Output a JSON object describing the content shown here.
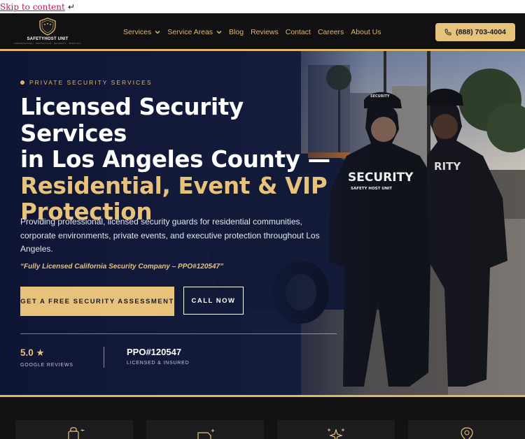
{
  "skip_link": {
    "label": "Skip to content",
    "return_glyph": "↵"
  },
  "brand": {
    "name": "SAFETYHOST UNIT",
    "tagline": "PROFESSIONAL · PROTECTION · SECURITY · SERVICES"
  },
  "nav": {
    "items": [
      {
        "label": "Services",
        "has_dropdown": true
      },
      {
        "label": "Service Areas",
        "has_dropdown": true
      },
      {
        "label": "Blog",
        "has_dropdown": false
      },
      {
        "label": "Reviews",
        "has_dropdown": false
      },
      {
        "label": "Contact",
        "has_dropdown": false
      },
      {
        "label": "Careers",
        "has_dropdown": false
      },
      {
        "label": "About Us",
        "has_dropdown": false
      }
    ],
    "phone": "(888) 703-4004"
  },
  "hero": {
    "eyebrow": "PRIVATE SECURITY SERVICES",
    "headline_white_1": "Licensed Security Services",
    "headline_white_2": "in Los Angeles County —",
    "headline_gold_1": "Residential, Event & VIP",
    "headline_gold_2": "Protection",
    "description": "Providing professional, licensed security guards for residential communities, corporate environments, private events, and executive protection throughout Los Angeles.",
    "license_line": "“Fully Licensed California Security Company – PPO#120547”",
    "cta_primary": "GET A FREE SECURITY ASSESSMENT",
    "cta_secondary": "CALL NOW",
    "stats": [
      {
        "value": "5.0 ★",
        "label": "GOOGLE REVIEWS"
      },
      {
        "value": "PPO#120547",
        "label": "LICENSED & INSURED"
      }
    ],
    "image_text": {
      "vest_1": "SECURITY",
      "vest_1_sub": "SAFETY HOST UNIT",
      "vest_2": "RITY",
      "cap": "SECURITY"
    }
  },
  "colors": {
    "gold": "#e7c27a",
    "header_bg": "#111114",
    "hero_overlay": "#0e1434",
    "link": "#c2185b"
  },
  "icons": [
    "return-arrow-icon",
    "shield-logo-icon",
    "chevron-down-icon",
    "phone-icon",
    "star-icon",
    "lock-service-icon",
    "document-service-icon",
    "sparkle-service-icon",
    "location-service-icon"
  ]
}
